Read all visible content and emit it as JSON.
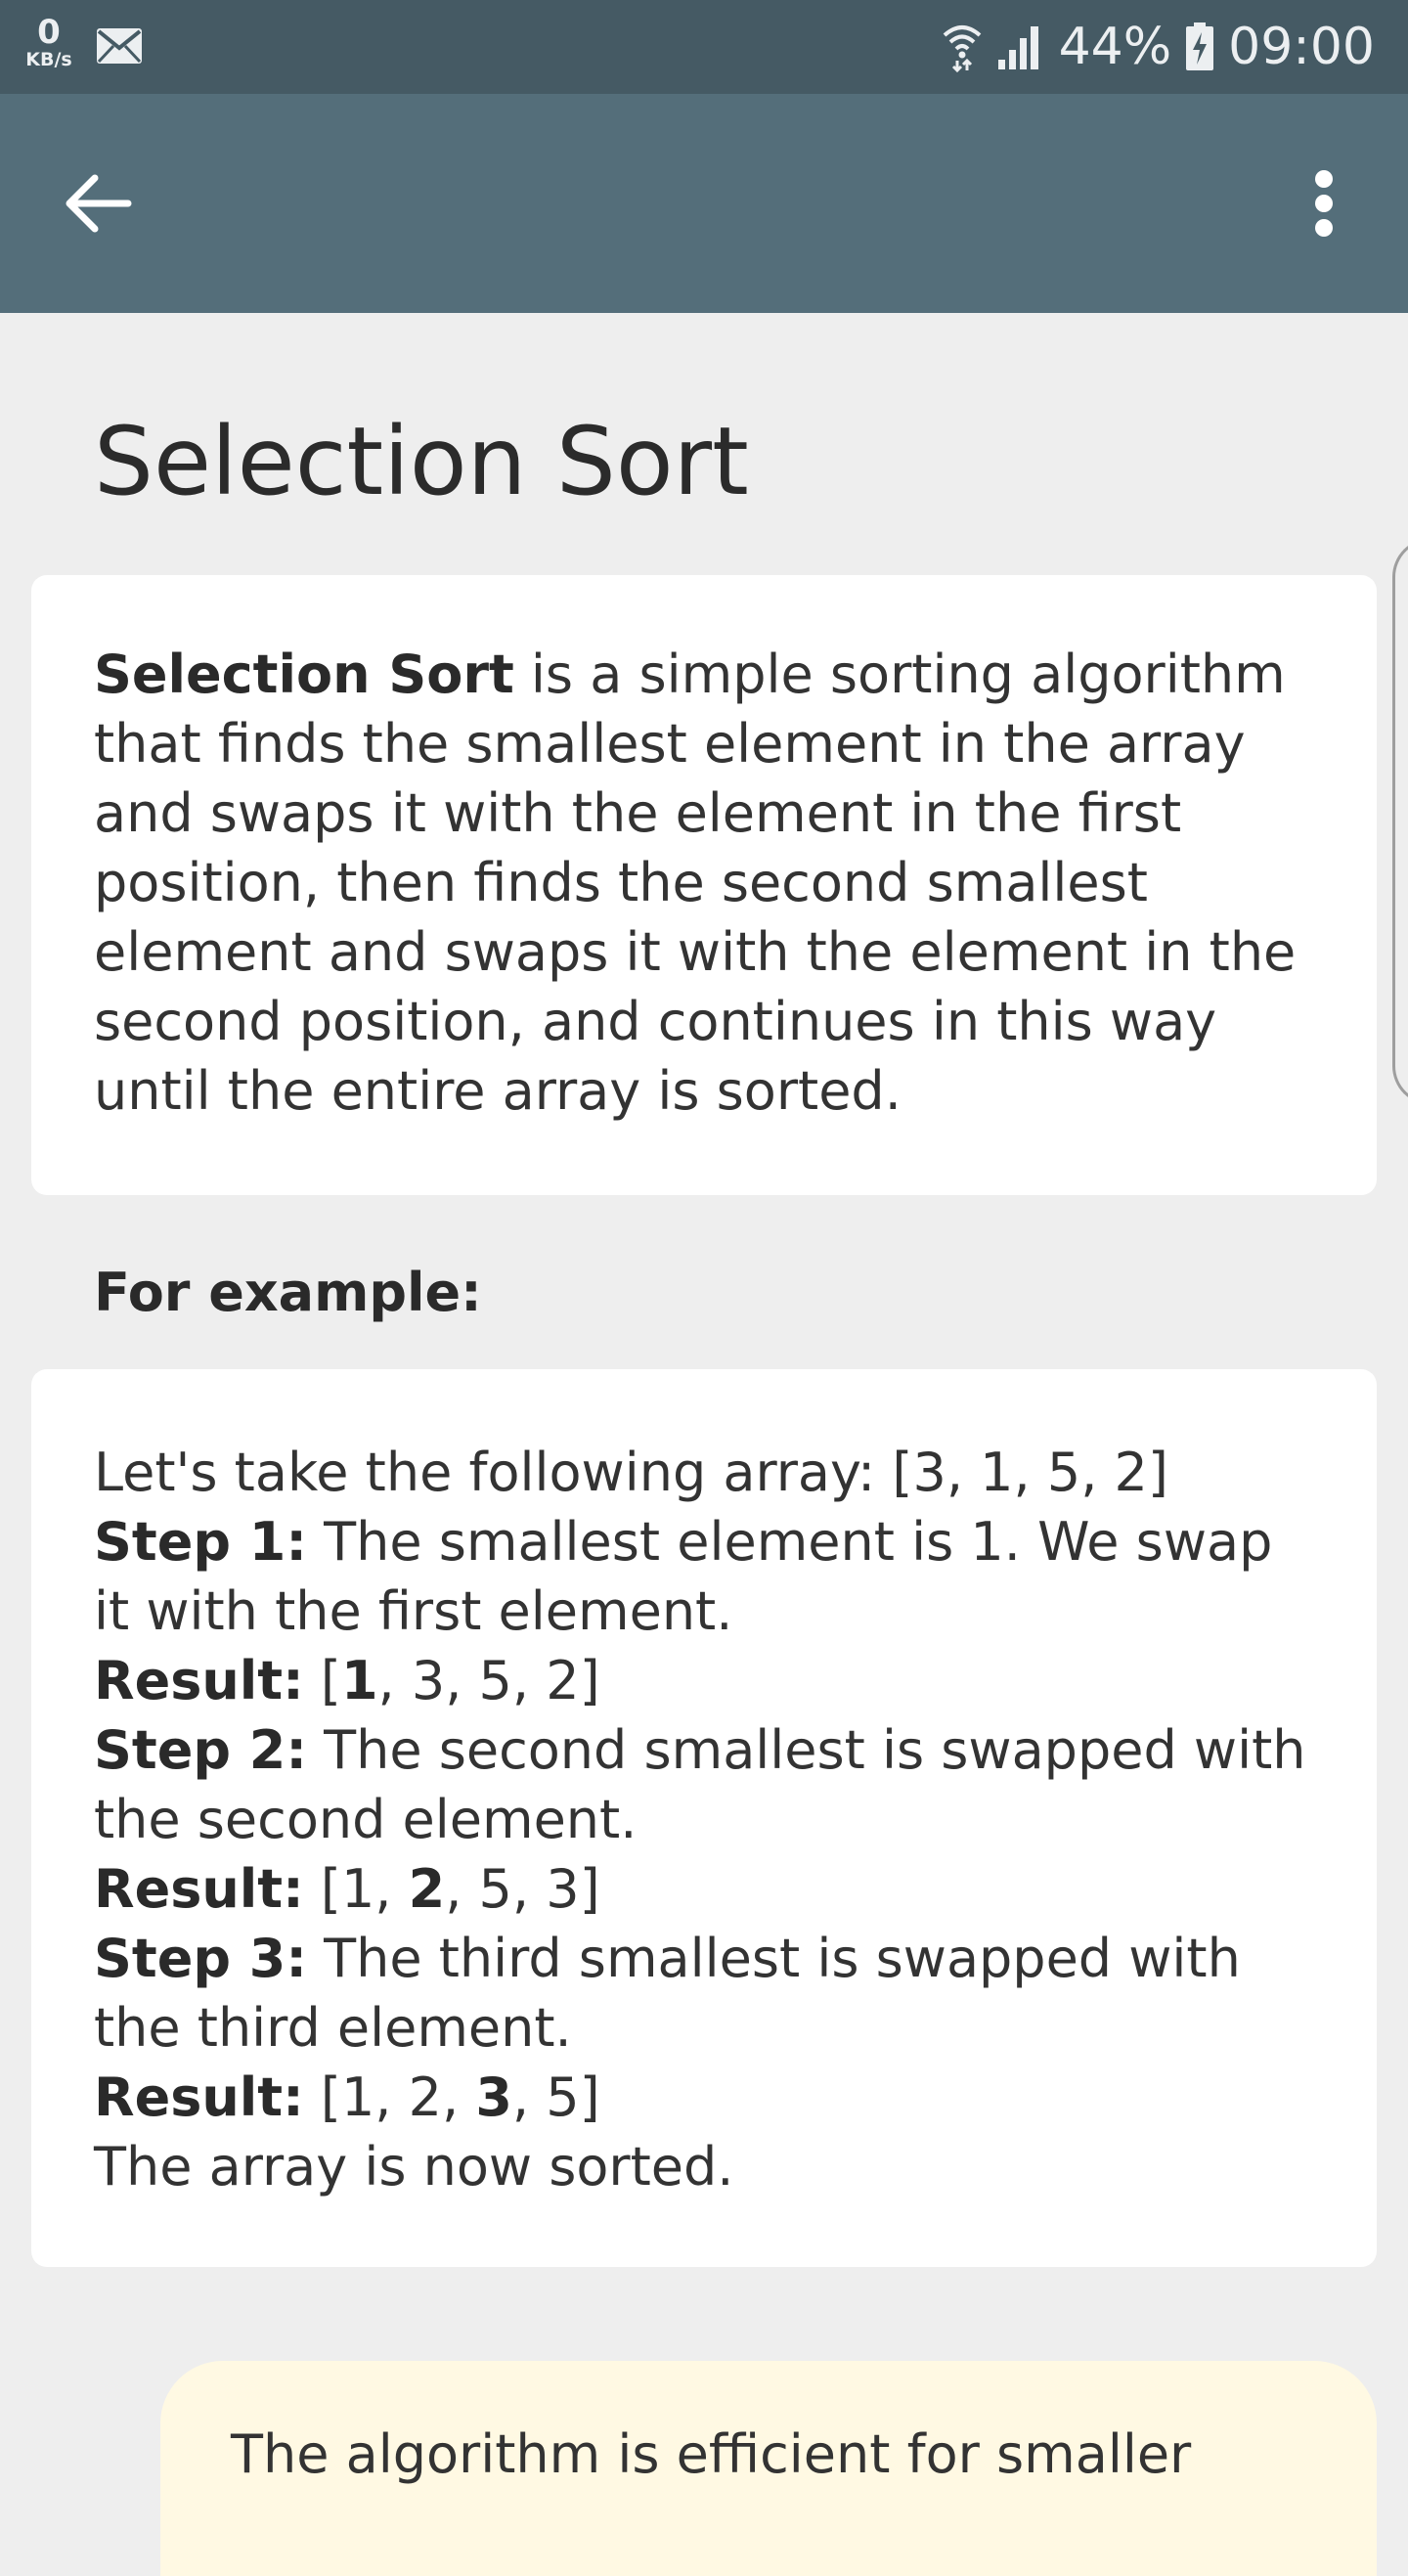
{
  "status_bar": {
    "net_speed_value": "0",
    "net_speed_unit": "KB/s",
    "battery": "44%",
    "time": "09:00",
    "icons": [
      "mail-icon",
      "wifi-icon",
      "signal-icon",
      "battery-charging-icon"
    ]
  },
  "app_bar": {
    "icons": [
      "back-arrow-icon",
      "more-vert-icon"
    ]
  },
  "page": {
    "title": "Selection Sort"
  },
  "intro": {
    "term": "Selection Sort",
    "text": " is a simple sorting algorithm that finds the smallest element in the array and swaps it with the element in the first position, then finds the second smallest element and swaps it with the element in the second position, and continues in this way until the entire array is sorted."
  },
  "example": {
    "heading": "For example:",
    "intro_line": "Let's take the following array: [3, 1, 5, 2]",
    "steps": [
      {
        "label": "Step 1:",
        "text": " The smallest element is 1. We swap it with the first element.",
        "result_label": "Result:",
        "result_open": " [",
        "result_bold": "1",
        "result_rest": ", 3, 5, 2]"
      },
      {
        "label": "Step 2:",
        "text": " The second smallest is swapped with the second element.",
        "result_label": "Result:",
        "result_open": " [1, ",
        "result_bold": "2",
        "result_rest": ", 5, 3]"
      },
      {
        "label": "Step 3:",
        "text": " The third smallest is swapped with the third element.",
        "result_label": "Result:",
        "result_open": " [1, 2, ",
        "result_bold": "3",
        "result_rest": ", 5]"
      }
    ],
    "conclusion": "The array is now sorted."
  },
  "note": {
    "text": "The algorithm is efficient for smaller"
  },
  "colors": {
    "status_bar": "#455a64",
    "app_bar": "#546e7a",
    "background": "#eeeeee",
    "card": "#ffffff",
    "note_card": "#fff9e3"
  }
}
